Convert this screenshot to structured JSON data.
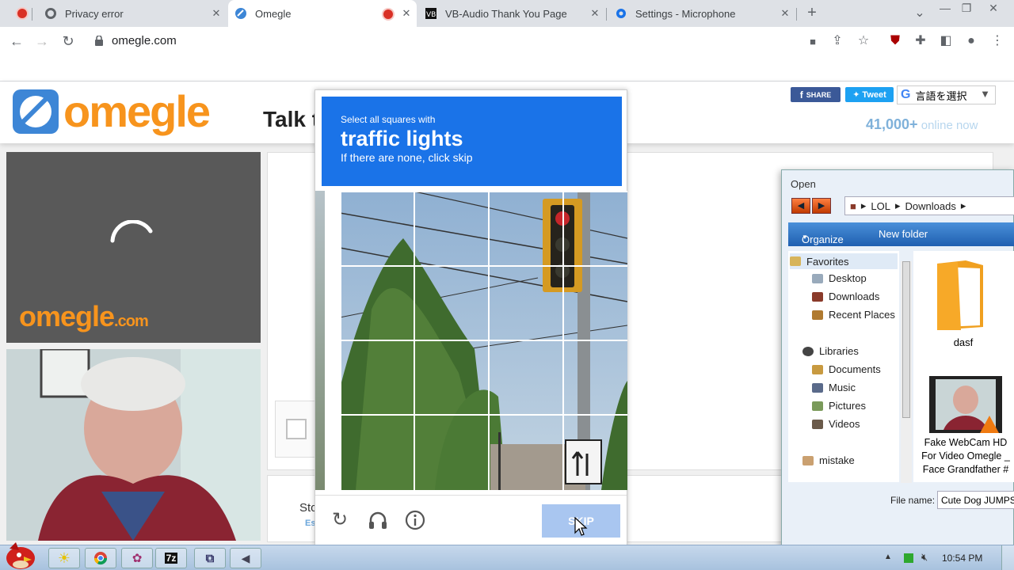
{
  "browser": {
    "tabs": [
      {
        "title": "Privacy error"
      },
      {
        "title": "Omegle"
      },
      {
        "title": "VB-Audio Thank You Page"
      },
      {
        "title": "Settings - Microphone"
      }
    ],
    "url": "omegle.com",
    "new_tab": "+",
    "tab_close": "✕"
  },
  "omegle": {
    "logo": "omegle",
    "tagline": "Talk t",
    "share": "SHARE",
    "tweet": "Tweet",
    "translate": "言語を選択",
    "online_count": "41,000+",
    "online_suffix": " online now",
    "video_watermark_main": "omegle",
    "video_watermark_tld": ".com",
    "bottom_text_1": "Sto",
    "bottom_text_2": "Es"
  },
  "captcha": {
    "instruction": "Select all squares with",
    "target": "traffic lights",
    "hint": "If there are none, click skip",
    "skip_label": "SKIP"
  },
  "open_dialog": {
    "title": "Open",
    "breadcrumb": [
      "LOL",
      "Downloads"
    ],
    "organize": "Organize",
    "new_folder": "New folder",
    "nav": {
      "favorites": "Favorites",
      "desktop": "Desktop",
      "downloads": "Downloads",
      "recent": "Recent Places",
      "libraries": "Libraries",
      "documents": "Documents",
      "music": "Music",
      "pictures": "Pictures",
      "videos": "Videos",
      "mistake": "mistake"
    },
    "files": [
      {
        "name": "dasf"
      },
      {
        "name": "Fake WebCam HD For Video Omegle _ Face Grandfather #"
      }
    ],
    "filename_label": "File name:",
    "filename_value": "Cute Dog JUMPSC"
  },
  "taskbar": {
    "app_7z": "7z",
    "clock": "10:54 PM"
  }
}
